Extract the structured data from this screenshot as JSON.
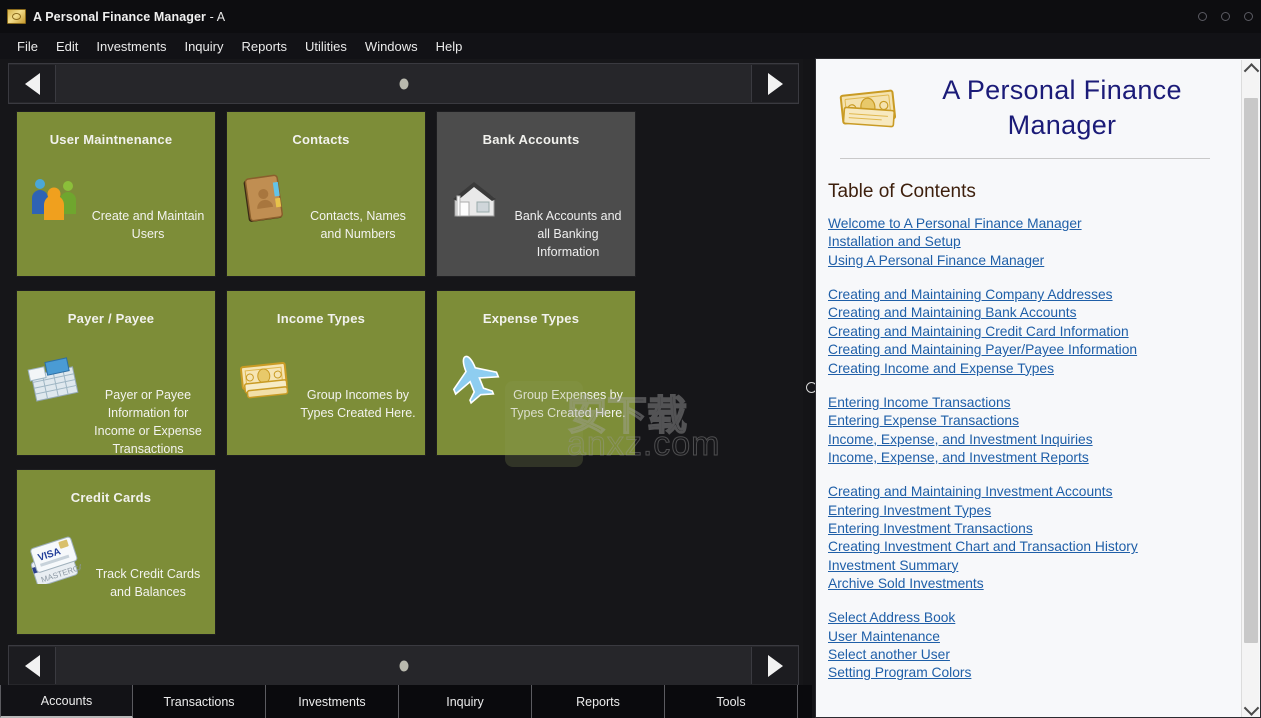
{
  "window": {
    "title": "A Personal Finance Manager",
    "title_suffix": " - A",
    "icon": "money-icon",
    "controls": [
      "minimize-dot",
      "maximize-dot",
      "close-dot"
    ]
  },
  "menubar": {
    "items": [
      {
        "label": "File"
      },
      {
        "label": "Edit"
      },
      {
        "label": "Investments"
      },
      {
        "label": "Inquiry"
      },
      {
        "label": "Reports"
      },
      {
        "label": "Utilities"
      },
      {
        "label": "Windows"
      },
      {
        "label": "Help"
      }
    ]
  },
  "nav": {
    "prev_icon": "triangle-left-icon",
    "next_icon": "triangle-right-icon",
    "handle_icon": "slider-dot-icon"
  },
  "tiles": [
    {
      "title": "User Maintnenance",
      "desc": "Create and Maintain Users",
      "icon": "users-group-icon",
      "selected": false
    },
    {
      "title": "Contacts",
      "desc": "Contacts, Names and Numbers",
      "icon": "address-book-icon",
      "selected": false
    },
    {
      "title": "Bank Accounts",
      "desc": "Bank Accounts and all Banking Information",
      "icon": "bank-building-icon",
      "selected": true
    },
    {
      "title": "Payer / Payee",
      "desc": "Payer or Payee Information for Income or Expense Transactions",
      "icon": "documents-icon",
      "selected": false
    },
    {
      "title": "Income Types",
      "desc": "Group Incomes by Types Created Here.",
      "icon": "cash-stack-icon",
      "selected": false
    },
    {
      "title": "Expense Types",
      "desc": "Group Expenses by Types Created Here.",
      "icon": "airplane-icon",
      "selected": false
    },
    {
      "title": "Credit Cards",
      "desc": "Track Credit Cards and Balances",
      "icon": "credit-card-icon",
      "selected": false
    }
  ],
  "watermark": {
    "latin": "anxz.com",
    "cjk": "安下载"
  },
  "tabs": [
    {
      "label": "Accounts",
      "active": true
    },
    {
      "label": "Transactions",
      "active": false
    },
    {
      "label": "Investments",
      "active": false
    },
    {
      "label": "Inquiry",
      "active": false
    },
    {
      "label": "Reports",
      "active": false
    },
    {
      "label": "Tools",
      "active": false
    }
  ],
  "help": {
    "banner_icon": "money-bills-icon",
    "title": "A Personal Finance Manager",
    "toc_heading": "Table of Contents",
    "groups": [
      {
        "links": [
          "Welcome to A Personal Finance Manager",
          "Installation and Setup",
          "Using A Personal Finance Manager"
        ]
      },
      {
        "links": [
          "Creating and Maintaining Company Addresses",
          "Creating and Maintaining Bank Accounts",
          "Creating and Maintaining Credit Card Information",
          "Creating and Maintaining Payer/Payee Information",
          "Creating Income and Expense Types"
        ]
      },
      {
        "links": [
          "Entering Income Transactions",
          "Entering Expense Transactions",
          "Income, Expense, and Investment Inquiries",
          "Income, Expense, and Investment Reports"
        ]
      },
      {
        "links": [
          "Creating and Maintaining Investment Accounts",
          "Entering Investment Types",
          "Entering Investment Transactions",
          "Creating Investment Chart and Transaction History",
          "Investment Summary",
          "Archive Sold Investments"
        ]
      },
      {
        "links": [
          "Select Address Book",
          "User Maintenance",
          "Select another User",
          "Setting Program Colors"
        ]
      }
    ],
    "scrollbar": {
      "up_icon": "chevron-up-icon",
      "down_icon": "chevron-down-icon"
    }
  },
  "colors": {
    "tile_green": "#7d8d38",
    "tile_selected_gray": "#4c4c4c",
    "app_background": "#161619",
    "help_link": "#1f5fa8",
    "help_title": "#1b1b78",
    "toc_heading": "#3d1f0c"
  }
}
